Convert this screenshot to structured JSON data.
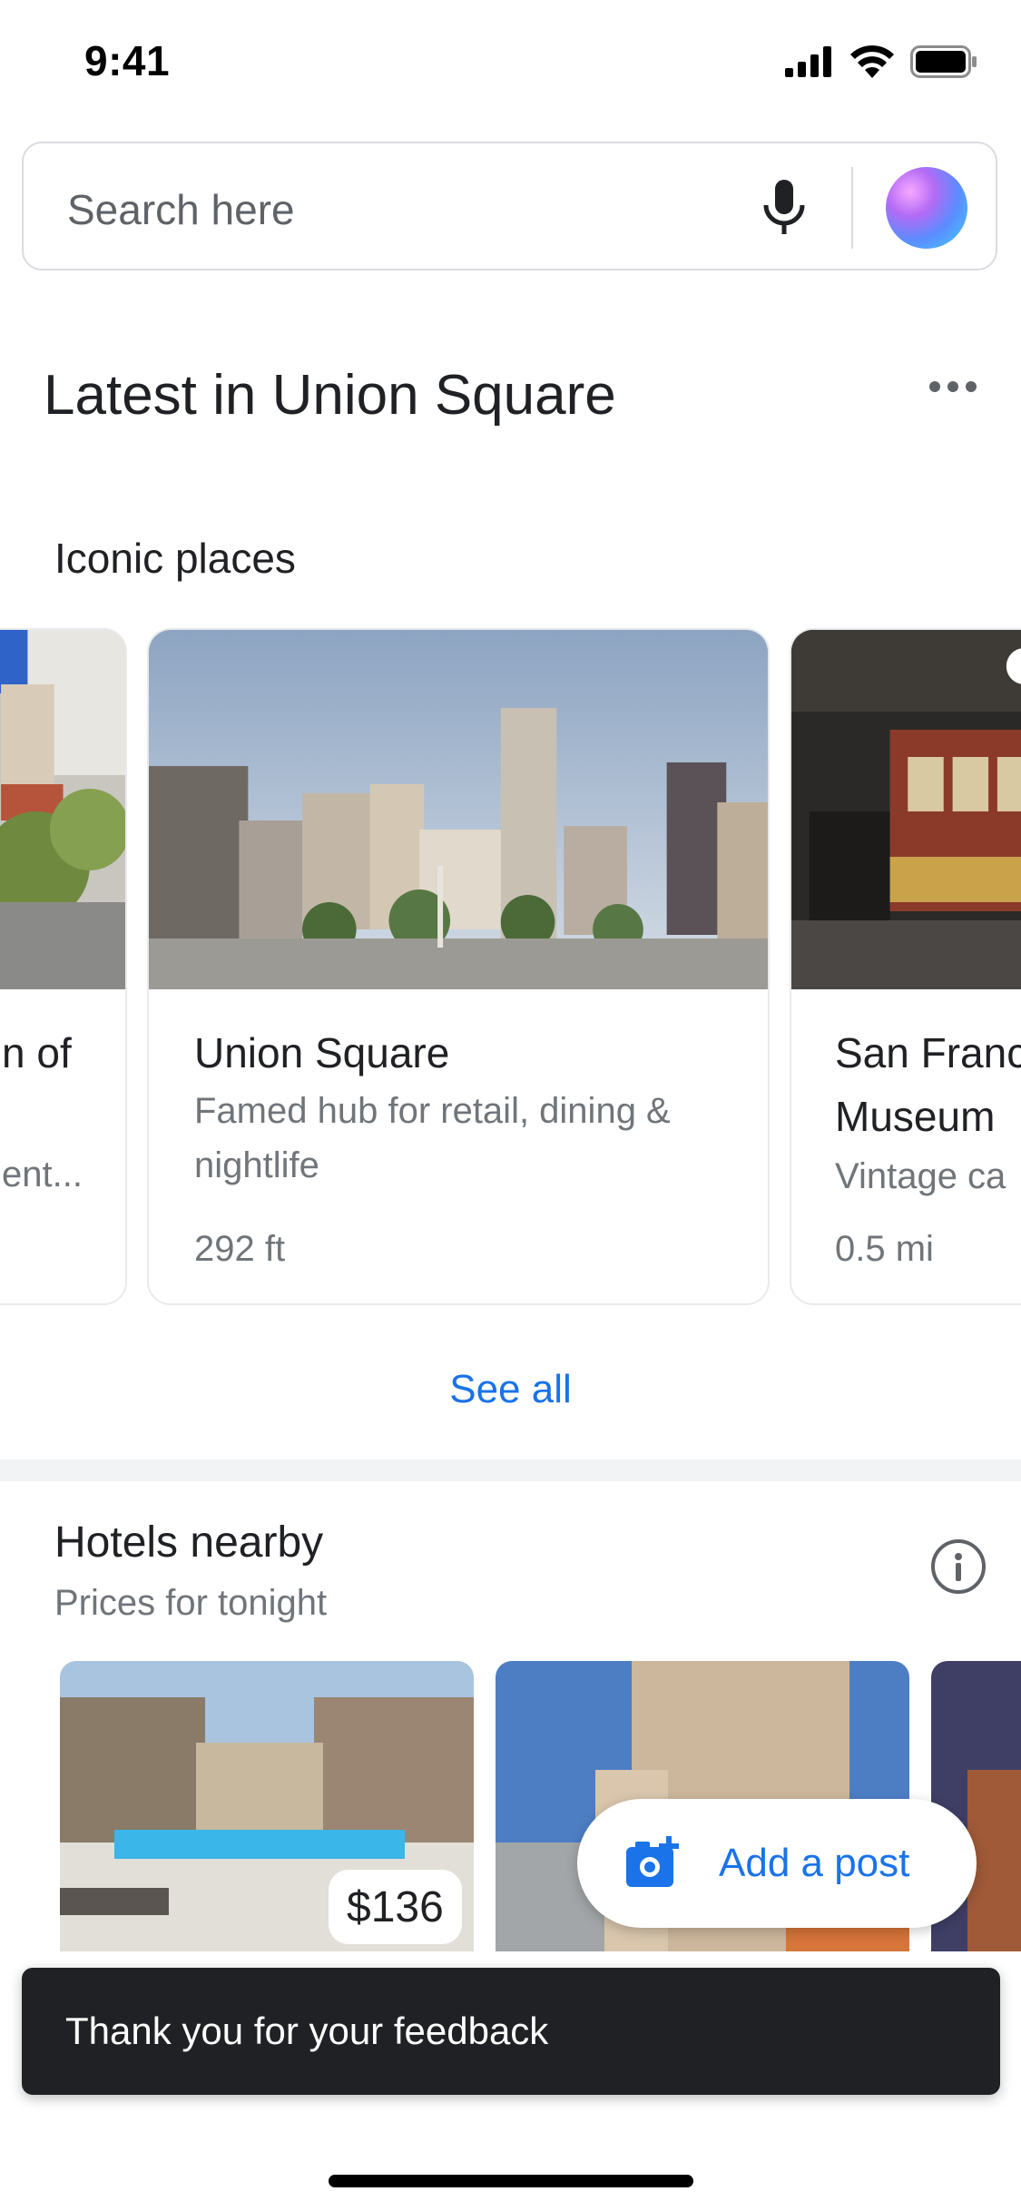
{
  "status_bar": {
    "time": "9:41",
    "icons": [
      "cellular-icon",
      "wifi-icon",
      "battery-icon"
    ]
  },
  "search": {
    "placeholder": "Search here",
    "icons": [
      "microphone-icon",
      "gemini-icon"
    ]
  },
  "header": {
    "title": "Latest in Union Square",
    "menu_icon": "more-horizontal-icon"
  },
  "iconic_places": {
    "title": "Iconic places",
    "cards": [
      {
        "title_partial": "n of",
        "desc_partial": "ent..."
      },
      {
        "title": "Union Square",
        "description": "Famed hub for retail, dining & nightlife",
        "distance": "292 ft"
      },
      {
        "title_line1": "San Franc",
        "title_line2": "Museum",
        "description": "Vintage ca",
        "distance": "0.5 mi"
      }
    ],
    "see_all": "See all"
  },
  "hotels": {
    "title": "Hotels nearby",
    "subtitle": "Prices for tonight",
    "info_icon": "info-icon",
    "items": [
      {
        "price": "$136"
      }
    ]
  },
  "fab": {
    "label": "Add a post",
    "icon": "add-photo-icon"
  },
  "toast": {
    "text": "Thank you for your feedback"
  },
  "colors": {
    "accent": "#1a73e8",
    "toast_bg": "#202124",
    "text_secondary": "#70757a"
  }
}
